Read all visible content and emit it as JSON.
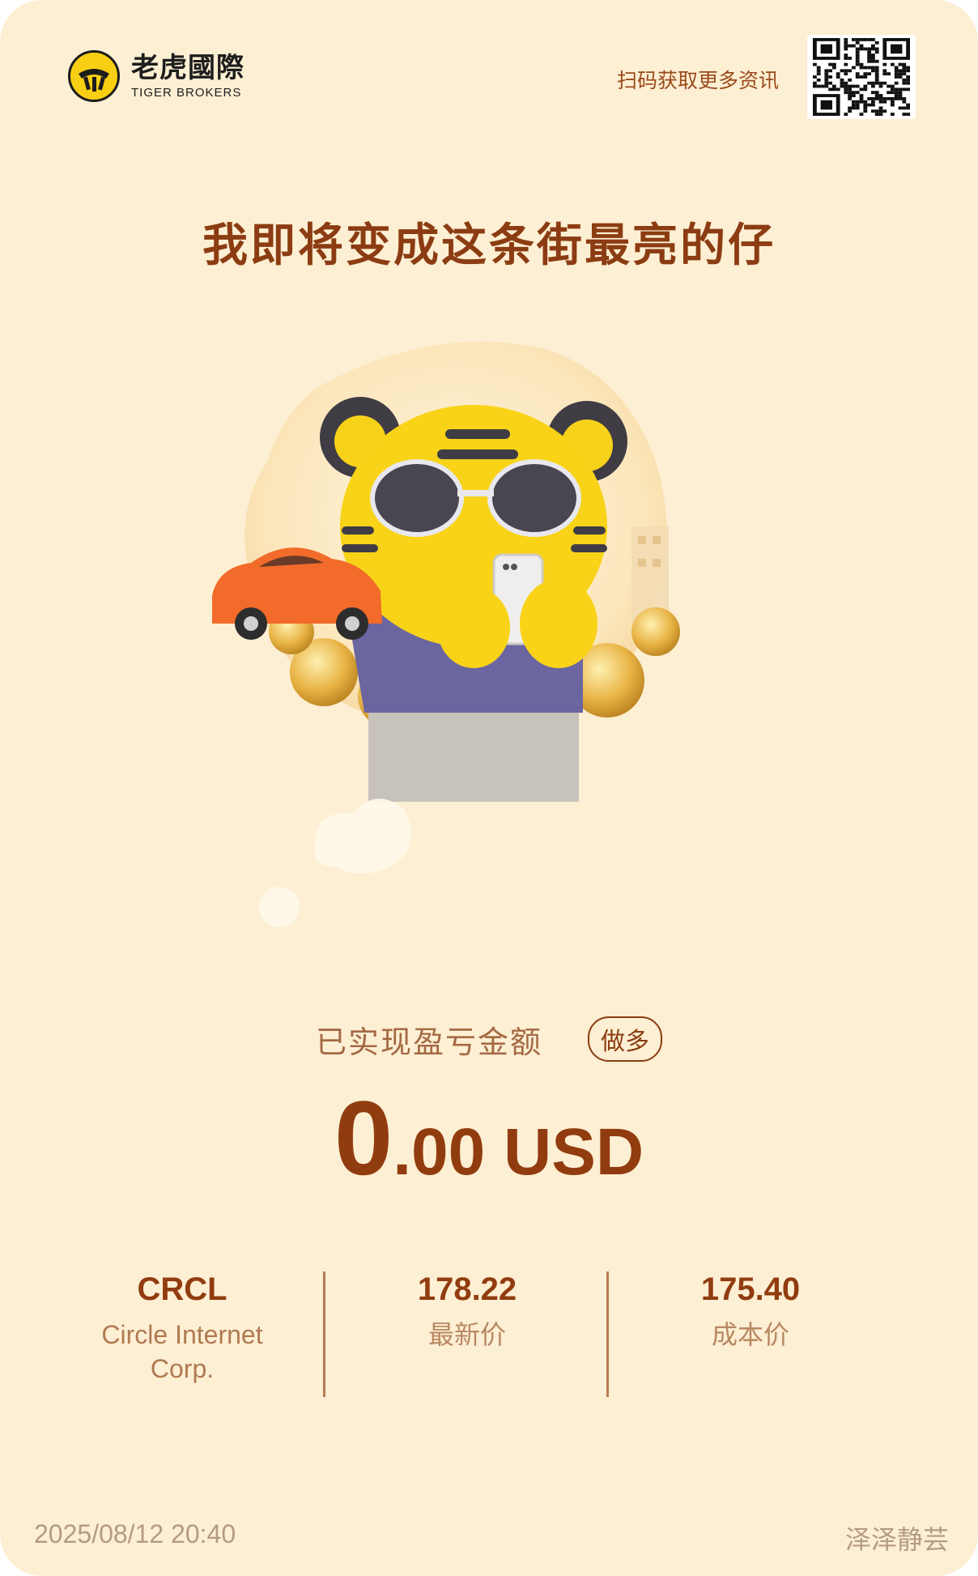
{
  "brand": {
    "name_cn": "老虎國際",
    "name_en": "TIGER BROKERS"
  },
  "header": {
    "scan_text": "扫码获取更多资讯"
  },
  "headline": "我即将变成这条街最亮的仔",
  "pnl": {
    "label": "已实现盈亏金额",
    "side_badge": "做多",
    "amount_big": "0",
    "amount_small": ".00 USD"
  },
  "stats": {
    "symbol": "CRCL",
    "company": "Circle Internet Corp.",
    "latest_price": "178.22",
    "latest_price_label": "最新价",
    "cost_price": "175.40",
    "cost_price_label": "成本价"
  },
  "footer": {
    "timestamp": "2025/08/12 20:40",
    "username": "泽泽静芸"
  },
  "colors": {
    "background": "#fdefd3",
    "accent": "#913c0f",
    "tiger_yellow": "#f8cf12"
  },
  "icons": [
    "tiger-logo-icon",
    "qr-code-icon",
    "tiger-mascot-illustration"
  ]
}
